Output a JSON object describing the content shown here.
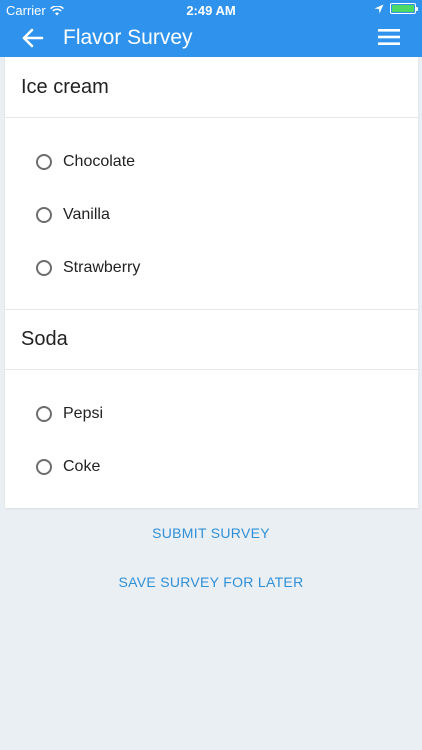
{
  "status_bar": {
    "carrier": "Carrier",
    "time": "2:49 AM"
  },
  "app_bar": {
    "title": "Flavor Survey",
    "back_icon": "arrow-left-icon",
    "menu_icon": "hamburger-menu-icon"
  },
  "sections": [
    {
      "title": "Ice cream",
      "options": [
        "Chocolate",
        "Vanilla",
        "Strawberry"
      ]
    },
    {
      "title": "Soda",
      "options": [
        "Pepsi",
        "Coke"
      ]
    }
  ],
  "actions": {
    "submit_label": "SUBMIT SURVEY",
    "save_label": "SAVE SURVEY FOR LATER"
  },
  "colors": {
    "app_bar": "#2f93ee",
    "background": "#eaeff4",
    "action_text": "#2f8fd8",
    "battery": "#4cd964"
  }
}
